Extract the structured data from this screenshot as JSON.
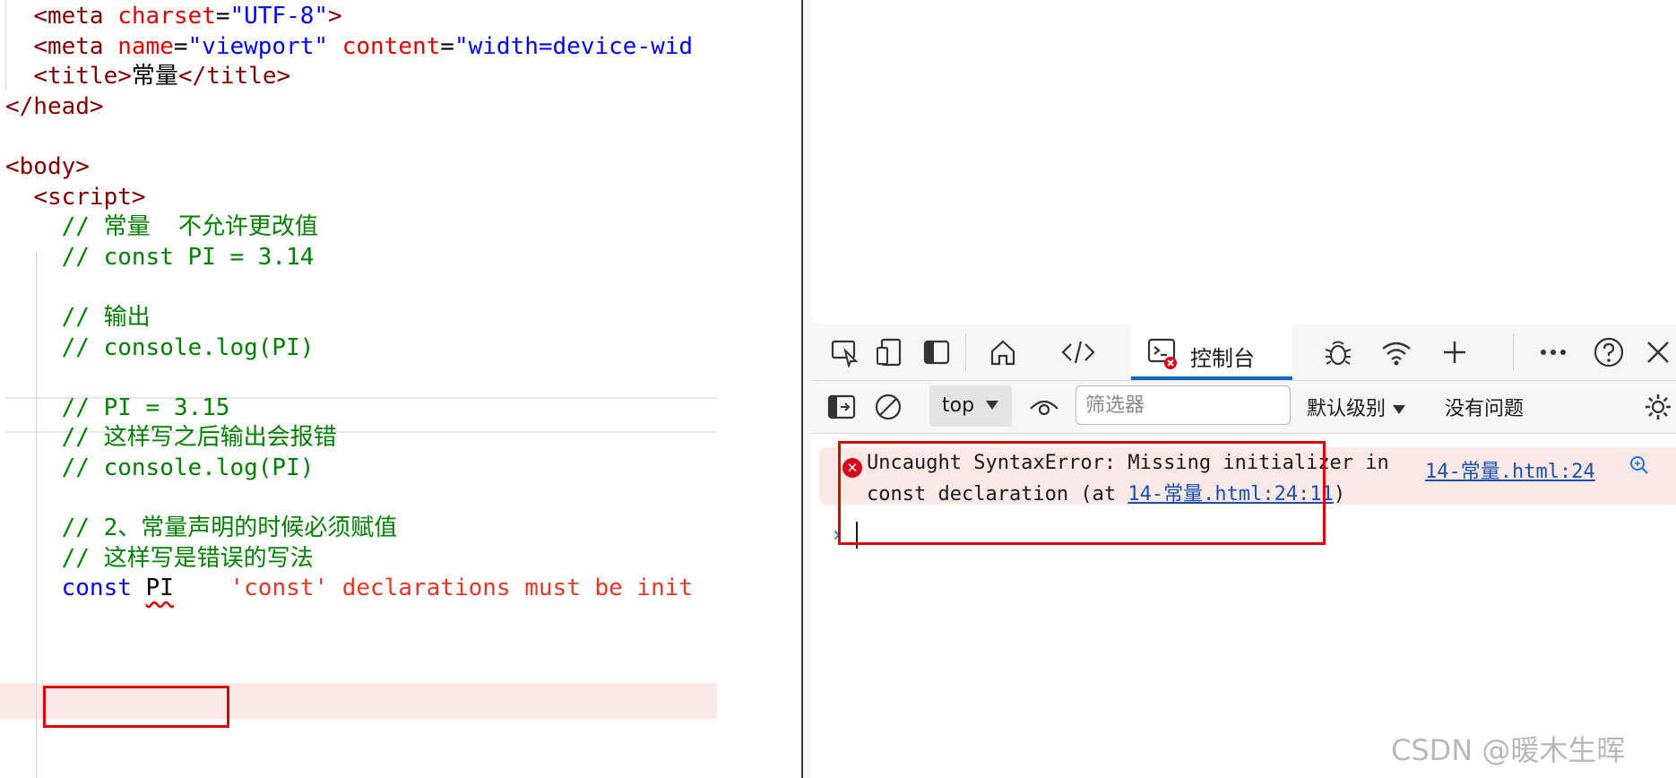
{
  "editor": {
    "lines": [
      {
        "indent": "  ",
        "parts": [
          [
            "tag",
            "<meta "
          ],
          [
            "attr",
            "charset"
          ],
          [
            "txt",
            "="
          ],
          [
            "str",
            "\"UTF-8\""
          ],
          [
            "tag",
            ">"
          ]
        ]
      },
      {
        "indent": "  ",
        "parts": [
          [
            "tag",
            "<meta "
          ],
          [
            "attr",
            "name"
          ],
          [
            "txt",
            "="
          ],
          [
            "str",
            "\"viewport\""
          ],
          [
            "txt",
            " "
          ],
          [
            "attr",
            "content"
          ],
          [
            "txt",
            "="
          ],
          [
            "str",
            "\"width=device-wid"
          ]
        ]
      },
      {
        "indent": "  ",
        "parts": [
          [
            "tag",
            "<title>"
          ],
          [
            "txt",
            "常量"
          ],
          [
            "tag",
            "</title>"
          ]
        ]
      },
      {
        "indent": "",
        "parts": [
          [
            "tag",
            "</head>"
          ]
        ]
      },
      {
        "indent": "",
        "parts": []
      },
      {
        "indent": "",
        "parts": [
          [
            "tag",
            "<body>"
          ]
        ]
      },
      {
        "indent": "  ",
        "parts": [
          [
            "tag",
            "<script>"
          ]
        ]
      },
      {
        "indent": "    ",
        "parts": [
          [
            "cmt",
            "// 常量  不允许更改值"
          ]
        ]
      },
      {
        "indent": "    ",
        "parts": [
          [
            "cmt",
            "// const PI = 3.14"
          ]
        ]
      },
      {
        "indent": "",
        "parts": []
      },
      {
        "indent": "    ",
        "parts": [
          [
            "cmt",
            "// 输出"
          ]
        ]
      },
      {
        "indent": "    ",
        "parts": [
          [
            "cmt",
            "// console.log(PI)"
          ]
        ]
      },
      {
        "indent": "",
        "parts": []
      },
      {
        "indent": "    ",
        "parts": [
          [
            "cmt",
            "// PI = 3.15"
          ]
        ]
      },
      {
        "indent": "    ",
        "parts": [
          [
            "cmt",
            "// 这样写之后输出会报错"
          ]
        ]
      },
      {
        "indent": "    ",
        "parts": [
          [
            "cmt",
            "// console.log(PI)"
          ]
        ]
      },
      {
        "indent": "",
        "parts": []
      },
      {
        "indent": "    ",
        "parts": [
          [
            "cmt",
            "// 2、常量声明的时候必须赋值"
          ]
        ]
      },
      {
        "indent": "    ",
        "parts": [
          [
            "cmt",
            "// 这样写是错误的写法"
          ]
        ]
      },
      {
        "indent": "    ",
        "parts": [
          [
            "kw",
            "const "
          ],
          [
            "squiggle",
            "PI"
          ],
          [
            "txt",
            "    "
          ],
          [
            "err-inline",
            "'const' declarations must be init"
          ]
        ]
      }
    ]
  },
  "devtools": {
    "tabs": {
      "inspect_icon": "inspect-element-icon",
      "device_icon": "device-emulation-icon",
      "sidebar_icon": "toggle-sidebar-icon",
      "welcome_icon": "home-icon",
      "elements_icon": "code-brackets-icon",
      "console_label": "控制台",
      "sources_icon": "bug-icon",
      "network_icon": "wifi-icon",
      "more_tools_icon": "plus-icon",
      "more_icon": "ellipsis-icon",
      "help_icon": "help-icon",
      "close_icon": "close-icon"
    },
    "toolbar": {
      "context_value": "top",
      "filter_placeholder": "筛选器",
      "levels_label": "默认级别",
      "issues_label": "没有问题"
    },
    "console": {
      "error_line1": "Uncaught SyntaxError: Missing initializer in",
      "error_line2_prefix": "const declaration (at ",
      "error_link": "14-常量.html:24:11",
      "error_line2_suffix": ")",
      "source_link": "14-常量.html:24",
      "prompt": "›"
    },
    "colors": {
      "error_bg": "#fde8e8",
      "error_red": "#d9001b",
      "link_blue": "#1a4fae",
      "active_tab": "#0f6cbd",
      "highlight_box": "#e00000"
    }
  },
  "watermark": "CSDN @暖木生晖"
}
